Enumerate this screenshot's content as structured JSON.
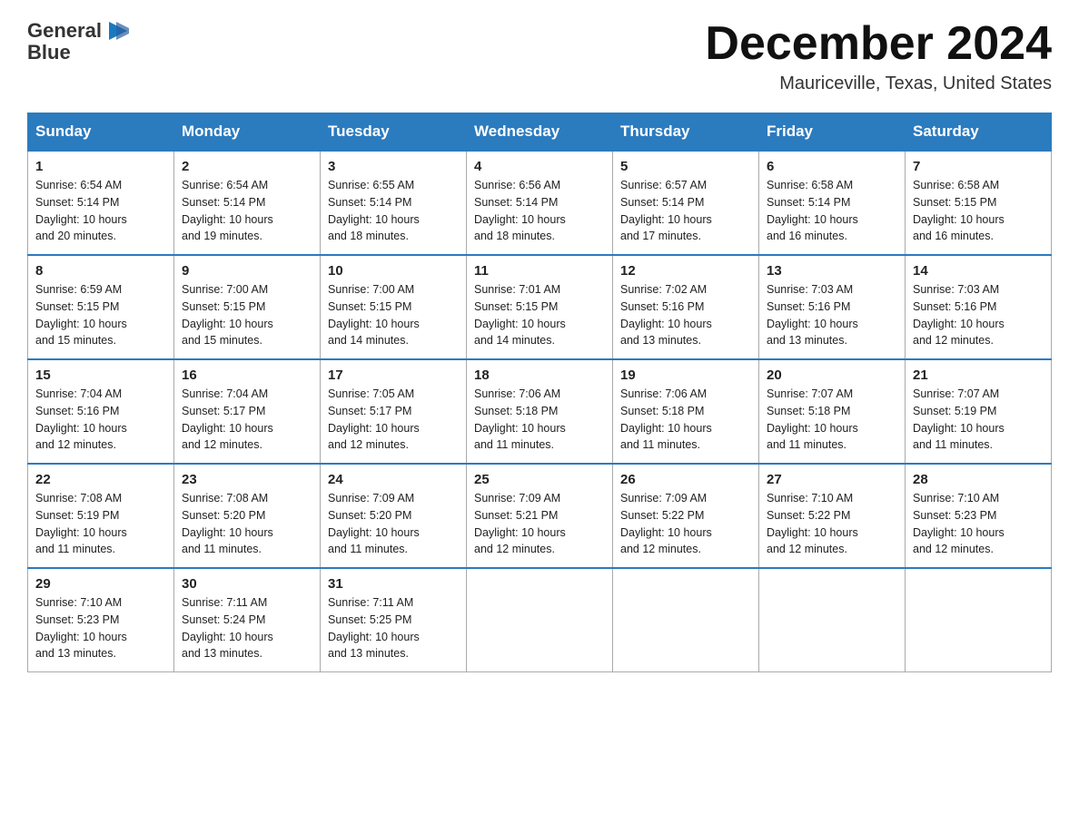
{
  "header": {
    "logo_line1": "General",
    "logo_line2": "Blue",
    "month_title": "December 2024",
    "location": "Mauriceville, Texas, United States"
  },
  "days_of_week": [
    "Sunday",
    "Monday",
    "Tuesday",
    "Wednesday",
    "Thursday",
    "Friday",
    "Saturday"
  ],
  "weeks": [
    [
      {
        "num": "1",
        "sunrise": "6:54 AM",
        "sunset": "5:14 PM",
        "daylight": "10 hours and 20 minutes."
      },
      {
        "num": "2",
        "sunrise": "6:54 AM",
        "sunset": "5:14 PM",
        "daylight": "10 hours and 19 minutes."
      },
      {
        "num": "3",
        "sunrise": "6:55 AM",
        "sunset": "5:14 PM",
        "daylight": "10 hours and 18 minutes."
      },
      {
        "num": "4",
        "sunrise": "6:56 AM",
        "sunset": "5:14 PM",
        "daylight": "10 hours and 18 minutes."
      },
      {
        "num": "5",
        "sunrise": "6:57 AM",
        "sunset": "5:14 PM",
        "daylight": "10 hours and 17 minutes."
      },
      {
        "num": "6",
        "sunrise": "6:58 AM",
        "sunset": "5:14 PM",
        "daylight": "10 hours and 16 minutes."
      },
      {
        "num": "7",
        "sunrise": "6:58 AM",
        "sunset": "5:15 PM",
        "daylight": "10 hours and 16 minutes."
      }
    ],
    [
      {
        "num": "8",
        "sunrise": "6:59 AM",
        "sunset": "5:15 PM",
        "daylight": "10 hours and 15 minutes."
      },
      {
        "num": "9",
        "sunrise": "7:00 AM",
        "sunset": "5:15 PM",
        "daylight": "10 hours and 15 minutes."
      },
      {
        "num": "10",
        "sunrise": "7:00 AM",
        "sunset": "5:15 PM",
        "daylight": "10 hours and 14 minutes."
      },
      {
        "num": "11",
        "sunrise": "7:01 AM",
        "sunset": "5:15 PM",
        "daylight": "10 hours and 14 minutes."
      },
      {
        "num": "12",
        "sunrise": "7:02 AM",
        "sunset": "5:16 PM",
        "daylight": "10 hours and 13 minutes."
      },
      {
        "num": "13",
        "sunrise": "7:03 AM",
        "sunset": "5:16 PM",
        "daylight": "10 hours and 13 minutes."
      },
      {
        "num": "14",
        "sunrise": "7:03 AM",
        "sunset": "5:16 PM",
        "daylight": "10 hours and 12 minutes."
      }
    ],
    [
      {
        "num": "15",
        "sunrise": "7:04 AM",
        "sunset": "5:16 PM",
        "daylight": "10 hours and 12 minutes."
      },
      {
        "num": "16",
        "sunrise": "7:04 AM",
        "sunset": "5:17 PM",
        "daylight": "10 hours and 12 minutes."
      },
      {
        "num": "17",
        "sunrise": "7:05 AM",
        "sunset": "5:17 PM",
        "daylight": "10 hours and 12 minutes."
      },
      {
        "num": "18",
        "sunrise": "7:06 AM",
        "sunset": "5:18 PM",
        "daylight": "10 hours and 11 minutes."
      },
      {
        "num": "19",
        "sunrise": "7:06 AM",
        "sunset": "5:18 PM",
        "daylight": "10 hours and 11 minutes."
      },
      {
        "num": "20",
        "sunrise": "7:07 AM",
        "sunset": "5:18 PM",
        "daylight": "10 hours and 11 minutes."
      },
      {
        "num": "21",
        "sunrise": "7:07 AM",
        "sunset": "5:19 PM",
        "daylight": "10 hours and 11 minutes."
      }
    ],
    [
      {
        "num": "22",
        "sunrise": "7:08 AM",
        "sunset": "5:19 PM",
        "daylight": "10 hours and 11 minutes."
      },
      {
        "num": "23",
        "sunrise": "7:08 AM",
        "sunset": "5:20 PM",
        "daylight": "10 hours and 11 minutes."
      },
      {
        "num": "24",
        "sunrise": "7:09 AM",
        "sunset": "5:20 PM",
        "daylight": "10 hours and 11 minutes."
      },
      {
        "num": "25",
        "sunrise": "7:09 AM",
        "sunset": "5:21 PM",
        "daylight": "10 hours and 12 minutes."
      },
      {
        "num": "26",
        "sunrise": "7:09 AM",
        "sunset": "5:22 PM",
        "daylight": "10 hours and 12 minutes."
      },
      {
        "num": "27",
        "sunrise": "7:10 AM",
        "sunset": "5:22 PM",
        "daylight": "10 hours and 12 minutes."
      },
      {
        "num": "28",
        "sunrise": "7:10 AM",
        "sunset": "5:23 PM",
        "daylight": "10 hours and 12 minutes."
      }
    ],
    [
      {
        "num": "29",
        "sunrise": "7:10 AM",
        "sunset": "5:23 PM",
        "daylight": "10 hours and 13 minutes."
      },
      {
        "num": "30",
        "sunrise": "7:11 AM",
        "sunset": "5:24 PM",
        "daylight": "10 hours and 13 minutes."
      },
      {
        "num": "31",
        "sunrise": "7:11 AM",
        "sunset": "5:25 PM",
        "daylight": "10 hours and 13 minutes."
      },
      null,
      null,
      null,
      null
    ]
  ],
  "labels": {
    "sunrise": "Sunrise:",
    "sunset": "Sunset:",
    "daylight": "Daylight:"
  }
}
